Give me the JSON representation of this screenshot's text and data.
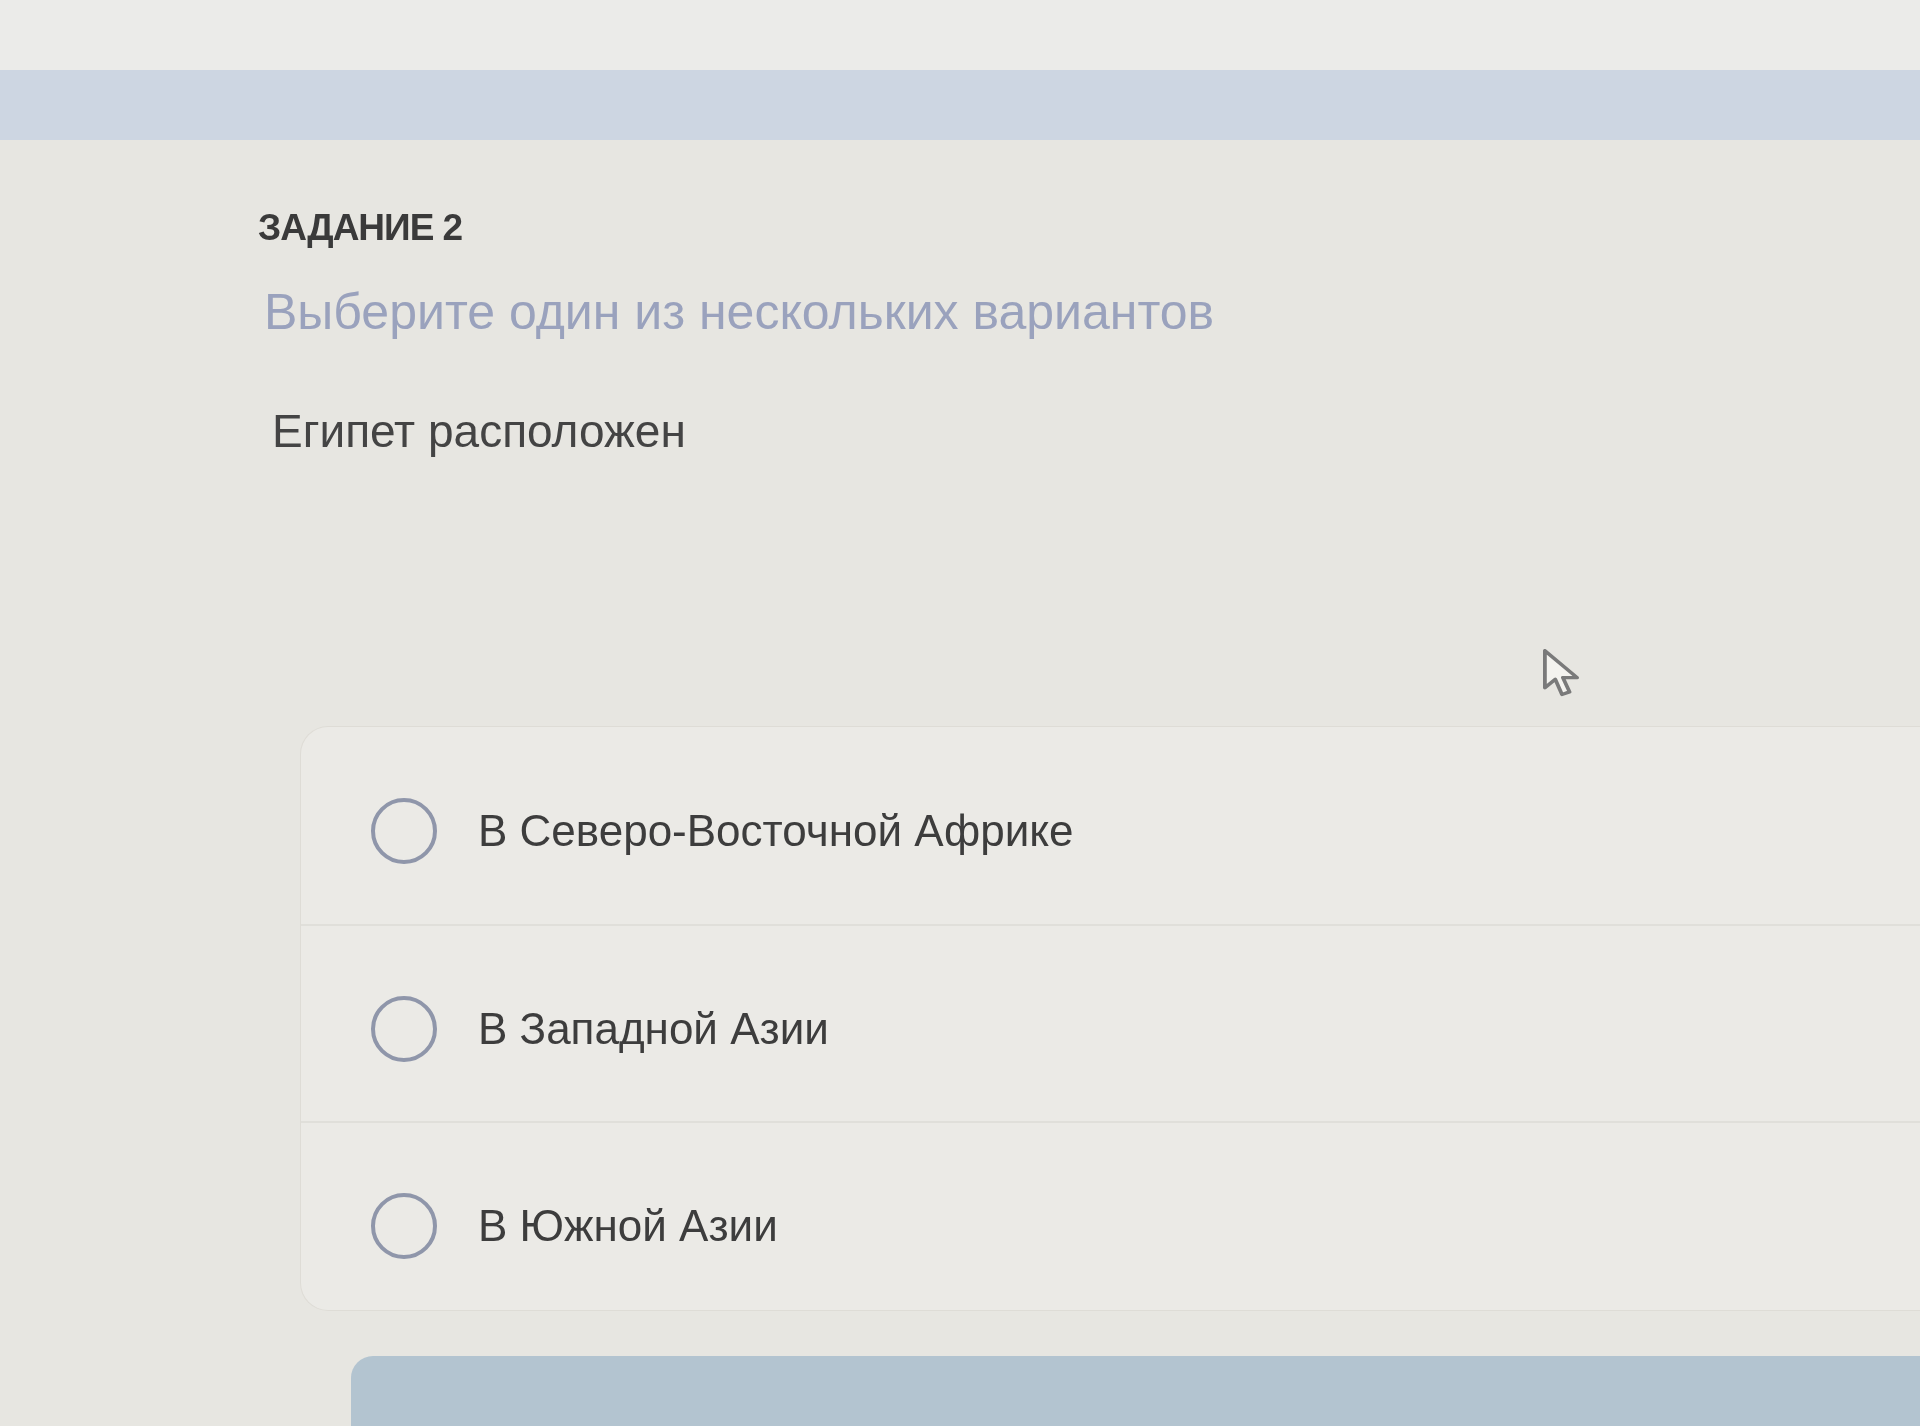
{
  "task": {
    "title": "ЗАДАНИЕ 2",
    "instruction": "Выберите один из нескольких вариантов",
    "question": "Египет расположен",
    "options": [
      {
        "label": "В Северо-Восточной Африке",
        "selected": false
      },
      {
        "label": "В Западной Азии",
        "selected": false
      },
      {
        "label": "В Южной Азии",
        "selected": false
      }
    ]
  }
}
